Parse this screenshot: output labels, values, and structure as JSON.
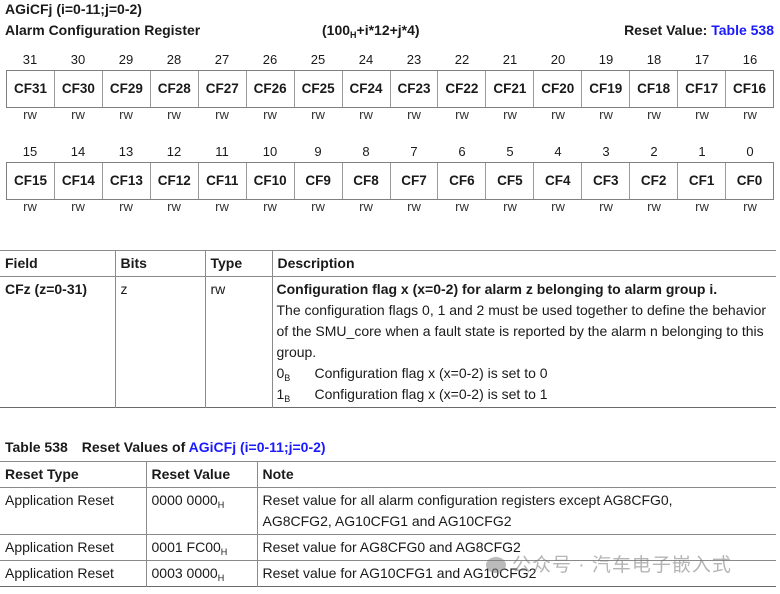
{
  "register": {
    "name": "AGiCFj (i=0-11;j=0-2)",
    "long_name": "Alarm Configuration Register",
    "offset_prefix": "(100",
    "offset_sub": "H",
    "offset_suffix": "+i*12+j*4)",
    "reset_label": "Reset Value: ",
    "reset_link": "Table 538"
  },
  "bitfield_rows": [
    {
      "bits": [
        "31",
        "30",
        "29",
        "28",
        "27",
        "26",
        "25",
        "24",
        "23",
        "22",
        "21",
        "20",
        "19",
        "18",
        "17",
        "16"
      ],
      "fields": [
        "CF31",
        "CF30",
        "CF29",
        "CF28",
        "CF27",
        "CF26",
        "CF25",
        "CF24",
        "CF23",
        "CF22",
        "CF21",
        "CF20",
        "CF19",
        "CF18",
        "CF17",
        "CF16"
      ],
      "access": [
        "rw",
        "rw",
        "rw",
        "rw",
        "rw",
        "rw",
        "rw",
        "rw",
        "rw",
        "rw",
        "rw",
        "rw",
        "rw",
        "rw",
        "rw",
        "rw"
      ]
    },
    {
      "bits": [
        "15",
        "14",
        "13",
        "12",
        "11",
        "10",
        "9",
        "8",
        "7",
        "6",
        "5",
        "4",
        "3",
        "2",
        "1",
        "0"
      ],
      "fields": [
        "CF15",
        "CF14",
        "CF13",
        "CF12",
        "CF11",
        "CF10",
        "CF9",
        "CF8",
        "CF7",
        "CF6",
        "CF5",
        "CF4",
        "CF3",
        "CF2",
        "CF1",
        "CF0"
      ],
      "access": [
        "rw",
        "rw",
        "rw",
        "rw",
        "rw",
        "rw",
        "rw",
        "rw",
        "rw",
        "rw",
        "rw",
        "rw",
        "rw",
        "rw",
        "rw",
        "rw"
      ]
    }
  ],
  "field_table": {
    "headers": [
      "Field",
      "Bits",
      "Type",
      "Description"
    ],
    "rows": [
      {
        "field": "CFz (z=0-31)",
        "bits": "z",
        "type": "rw",
        "desc_title": "Configuration flag x (x=0-2) for alarm z belonging to alarm group i.",
        "desc_body": "The configuration flags 0, 1 and 2 must be used together to define the behavior of the SMU_core when a fault state is reported by the alarm n belonging to this group.",
        "enums": [
          {
            "value": "0",
            "sub": "B",
            "text": "Configuration flag x (x=0-2) is set to 0"
          },
          {
            "value": "1",
            "sub": "B",
            "text": "Configuration flag x (x=0-2) is set to 1"
          }
        ]
      }
    ]
  },
  "reset_table": {
    "caption_num": "Table 538",
    "caption_text": "Reset Values of ",
    "caption_link": "AGiCFj (i=0-11;j=0-2)",
    "headers": [
      "Reset Type",
      "Reset Value",
      "Note"
    ],
    "rows": [
      {
        "type": "Application Reset",
        "value": "0000 0000",
        "sub": "H",
        "note": "Reset value for all alarm configuration registers except AG8CFG0, AG8CFG2, AG10CFG1 and AG10CFG2"
      },
      {
        "type": "Application Reset",
        "value": "0001 FC00",
        "sub": "H",
        "note": "Reset value for AG8CFG0 and AG8CFG2"
      },
      {
        "type": "Application Reset",
        "value": "0003 0000",
        "sub": "H",
        "note": "Reset value for AG10CFG1 and AG10CFG2"
      }
    ]
  },
  "watermark": "公众号 · 汽车电子嵌入式",
  "colors": {
    "link": "#1a1aff",
    "text": "#1a1a1a",
    "rule": "#8a8a8a"
  }
}
